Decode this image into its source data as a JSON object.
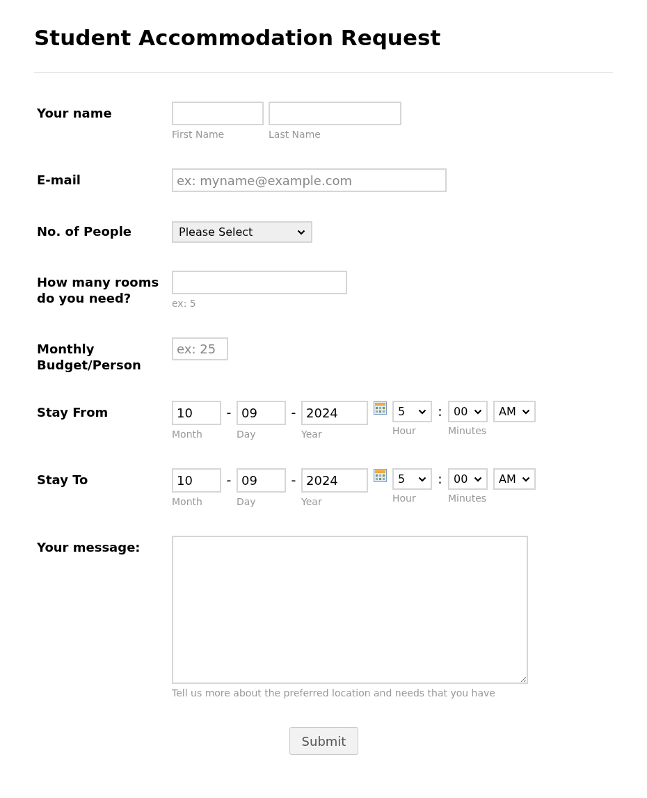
{
  "title": "Student Accommodation Request",
  "fields": [
    {
      "kind": "name",
      "label": "Your name",
      "parts": [
        {
          "sublabel": "First Name"
        },
        {
          "sublabel": "Last Name"
        }
      ]
    },
    {
      "kind": "email",
      "label": "E-mail",
      "placeholder": "ex: myname@example.com"
    },
    {
      "kind": "select",
      "label": "No. of People",
      "value": "Please Select"
    },
    {
      "kind": "text",
      "label": "How many rooms do you need?",
      "sublabel": "ex: 5"
    },
    {
      "kind": "budget",
      "label": "Monthly Budget/Person",
      "placeholder": "ex: 25"
    },
    {
      "kind": "datetime",
      "label": "Stay From",
      "month": "10",
      "day": "09",
      "year": "2024",
      "hour": "5",
      "minute": "00",
      "ampm": "AM",
      "date_separator": "-",
      "time_separator": ":",
      "sublabels": {
        "month": "Month",
        "day": "Day",
        "year": "Year",
        "hour": "Hour",
        "minutes": "Minutes"
      }
    },
    {
      "kind": "datetime",
      "label": "Stay To",
      "month": "10",
      "day": "09",
      "year": "2024",
      "hour": "5",
      "minute": "00",
      "ampm": "AM",
      "date_separator": "-",
      "time_separator": ":",
      "sublabels": {
        "month": "Month",
        "day": "Day",
        "year": "Year",
        "hour": "Hour",
        "minutes": "Minutes"
      }
    },
    {
      "kind": "textarea",
      "label": "Your message:",
      "sublabel": "Tell us more about the preferred location and needs that you have"
    }
  ],
  "submit": "Submit"
}
